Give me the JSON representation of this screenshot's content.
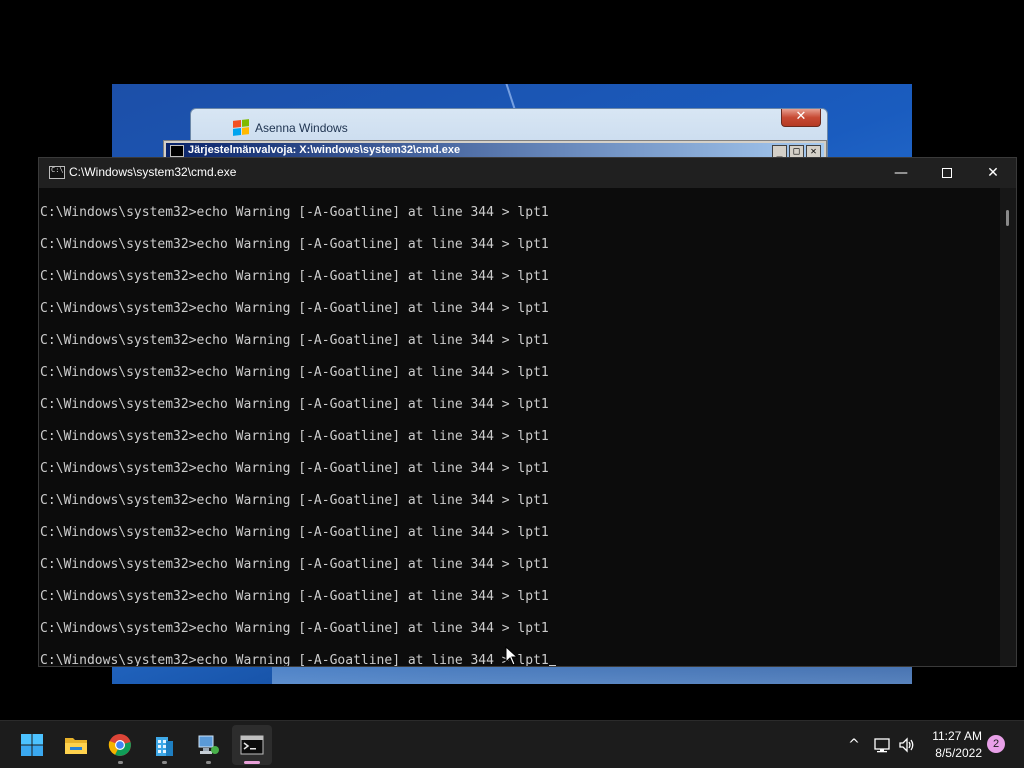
{
  "background_windows": {
    "setup_title": "Asenna Windows",
    "setup_close_glyph": "✕",
    "sysmon_title": "Järjestelmänvalvoja: X:\\windows\\system32\\cmd.exe",
    "sysmon_min_glyph": "_",
    "sysmon_max_glyph": "□",
    "sysmon_close_glyph": "✕"
  },
  "cmd_window": {
    "title": "C:\\Windows\\system32\\cmd.exe",
    "minimize_glyph": "—",
    "close_glyph": "✕",
    "lines": [
      "C:\\Windows\\system32>echo Warning [-A-Goatline] at line 344 > lpt1",
      "C:\\Windows\\system32>echo Warning [-A-Goatline] at line 344 > lpt1",
      "C:\\Windows\\system32>echo Warning [-A-Goatline] at line 344 > lpt1",
      "C:\\Windows\\system32>echo Warning [-A-Goatline] at line 344 > lpt1",
      "C:\\Windows\\system32>echo Warning [-A-Goatline] at line 344 > lpt1",
      "C:\\Windows\\system32>echo Warning [-A-Goatline] at line 344 > lpt1",
      "C:\\Windows\\system32>echo Warning [-A-Goatline] at line 344 > lpt1",
      "C:\\Windows\\system32>echo Warning [-A-Goatline] at line 344 > lpt1",
      "C:\\Windows\\system32>echo Warning [-A-Goatline] at line 344 > lpt1",
      "C:\\Windows\\system32>echo Warning [-A-Goatline] at line 344 > lpt1",
      "C:\\Windows\\system32>echo Warning [-A-Goatline] at line 344 > lpt1",
      "C:\\Windows\\system32>echo Warning [-A-Goatline] at line 344 > lpt1",
      "C:\\Windows\\system32>echo Warning [-A-Goatline] at line 344 > lpt1",
      "C:\\Windows\\system32>echo Warning [-A-Goatline] at line 344 > lpt1",
      "C:\\Windows\\system32>echo Warning [-A-Goatline] at line 344 > lpt1"
    ]
  },
  "taskbar": {
    "apps": [
      {
        "name": "start-button",
        "icon": "windows-logo-icon",
        "running": false,
        "active": false
      },
      {
        "name": "file-explorer",
        "icon": "folder-icon",
        "running": false,
        "active": false
      },
      {
        "name": "chrome",
        "icon": "chrome-icon",
        "running": true,
        "active": false
      },
      {
        "name": "tool-app-1",
        "icon": "building-icon",
        "running": true,
        "active": false
      },
      {
        "name": "tool-app-2",
        "icon": "network-computer-icon",
        "running": true,
        "active": false
      },
      {
        "name": "command-prompt",
        "icon": "terminal-icon",
        "running": true,
        "active": true
      }
    ],
    "tray": {
      "chevron_glyph": "^",
      "network_icon": "network-icon",
      "volume_icon": "volume-icon",
      "time": "11:27 AM",
      "date": "8/5/2022",
      "notification_count": "2"
    }
  }
}
